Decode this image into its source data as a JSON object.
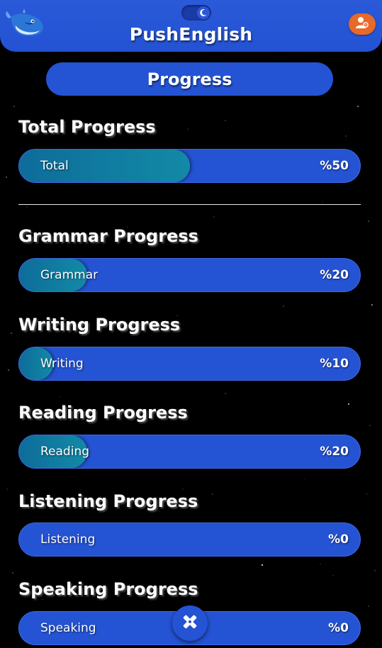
{
  "header": {
    "app_title": "PushEnglish",
    "logo_icon": "whale-icon",
    "theme_toggle_icon": "moon-icon",
    "profile_icon": "user-settings-icon"
  },
  "section": {
    "title": "Progress"
  },
  "progress": [
    {
      "key": "total",
      "title": "Total Progress",
      "label": "Total",
      "value_text": "%50",
      "percent": 50
    },
    {
      "key": "grammar",
      "title": "Grammar Progress",
      "label": "Grammar",
      "value_text": "%20",
      "percent": 20
    },
    {
      "key": "writing",
      "title": "Writing Progress",
      "label": "Writing",
      "value_text": "%10",
      "percent": 10
    },
    {
      "key": "reading",
      "title": "Reading Progress",
      "label": "Reading",
      "value_text": "%20",
      "percent": 20
    },
    {
      "key": "listening",
      "title": "Listening Progress",
      "label": "Listening",
      "value_text": "%0",
      "percent": 0
    },
    {
      "key": "speaking",
      "title": "Speaking Progress",
      "label": "Speaking",
      "value_text": "%0",
      "percent": 0
    }
  ],
  "fab": {
    "icon": "tools-icon"
  },
  "colors": {
    "primary": "#2453d4",
    "fill": "#128aa6",
    "accent": "#e8692a",
    "background": "#000000"
  }
}
